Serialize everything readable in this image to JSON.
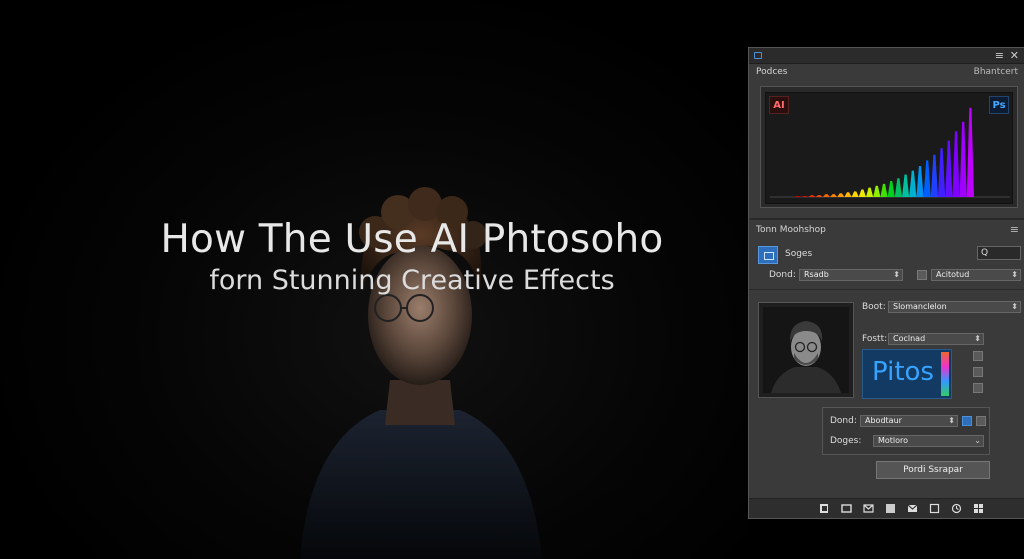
{
  "hero": {
    "title_line1": "How The Use AI Phtosoho",
    "title_line2": "forn Stunning Creative Effects"
  },
  "panel": {
    "titlebar": {
      "menu_glyph": "≡",
      "close_glyph": "✕"
    },
    "histogram_section": {
      "title": "Podces",
      "right_label": "Bhantcert",
      "badge_left": "AI",
      "badge_right": "Ps"
    },
    "chart_data": {
      "type": "bar",
      "values": [
        1,
        1,
        2,
        2,
        3,
        3,
        4,
        5,
        6,
        8,
        10,
        12,
        14,
        17,
        20,
        24,
        28,
        33,
        39,
        45,
        52,
        60,
        70,
        80,
        95
      ],
      "colors": [
        "#d80000",
        "#e01000",
        "#e83000",
        "#f04a00",
        "#f56400",
        "#fa8000",
        "#ff9c00",
        "#ffb800",
        "#ffd400",
        "#f0e800",
        "#c8f000",
        "#8ef000",
        "#40e000",
        "#00d020",
        "#00c060",
        "#00c0a0",
        "#00b0d0",
        "#0090f0",
        "#0060ff",
        "#2040ff",
        "#4020ff",
        "#6010ff",
        "#8000ff",
        "#a000ff",
        "#c000ff"
      ],
      "ylim": [
        0,
        100
      ]
    },
    "tools_section": {
      "title": "Tonn Moohshop",
      "menu_glyph": "≡",
      "layer_label": "Soges",
      "search_text": "Q",
      "row1_label": "Dond:",
      "row1_field1": "Rsadb",
      "row1_field2": "Acitotud",
      "row2_label": "Boot:",
      "row2_field": "Slomanclelon",
      "row3_label": "Fostt:",
      "row3_field": "Coclnad",
      "pitos_text": "Pitos",
      "row4_label": "Dond:",
      "row4_field": "Abodtaur",
      "row5_label": "Doges:",
      "row5_field": "Motloro",
      "button_label": "Pordi Ssrapar"
    },
    "bottom_tools": [
      "new-layer-icon",
      "layer-icon",
      "mask-icon",
      "adjustment-icon",
      "mail-icon",
      "square-icon",
      "history-icon",
      "grid-icon"
    ]
  }
}
